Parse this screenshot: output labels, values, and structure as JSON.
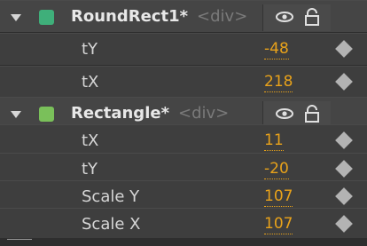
{
  "elements": [
    {
      "name": "RoundRect1*",
      "tag": "<div>",
      "color": "#3faf7a",
      "icons": [
        "eye-icon",
        "lock-icon"
      ],
      "properties": [
        {
          "name": "tY",
          "value": "-48"
        },
        {
          "name": "tX",
          "value": "218"
        }
      ]
    },
    {
      "name": "Rectangle*",
      "tag": "<div>",
      "color": "#7ac05a",
      "icons": [
        "eye-icon",
        "lock-icon"
      ],
      "properties": [
        {
          "name": "tX",
          "value": "11"
        },
        {
          "name": "tY",
          "value": "-20"
        },
        {
          "name": "Scale Y",
          "value": "107"
        },
        {
          "name": "Scale X",
          "value": "107"
        }
      ]
    }
  ],
  "colors": {
    "value_accent": "#e8a21a",
    "keyframe": "#b3b3b3"
  }
}
